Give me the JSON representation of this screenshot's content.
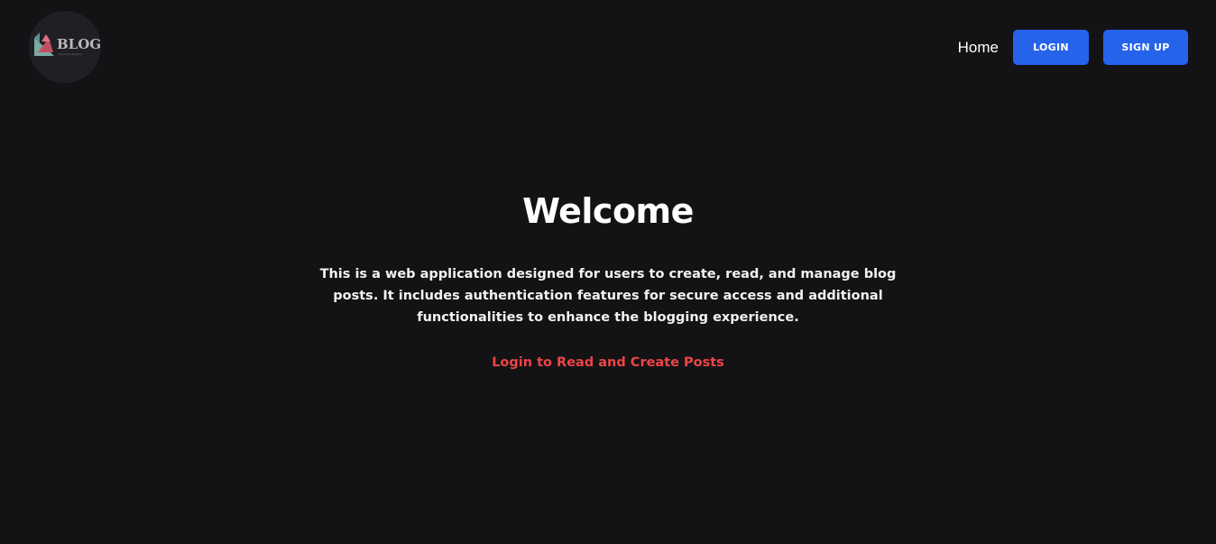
{
  "header": {
    "logo": {
      "word": "BLOG",
      "tagline": "Build Your Blogging",
      "icon": "blog-logo-icon"
    },
    "nav": {
      "home_label": "Home",
      "login_label": "LOGIN",
      "signup_label": "SIGN UP"
    }
  },
  "hero": {
    "title": "Welcome",
    "description": "This is a web application designed for users to create, read, and manage blog posts. It includes authentication features for secure access and additional functionalities to enhance the blogging experience.",
    "cta_label": "Login to Read and Create Posts"
  },
  "colors": {
    "background": "#131316",
    "accent_button": "#2563eb",
    "cta_text": "#ef4444",
    "text": "#ffffff"
  }
}
